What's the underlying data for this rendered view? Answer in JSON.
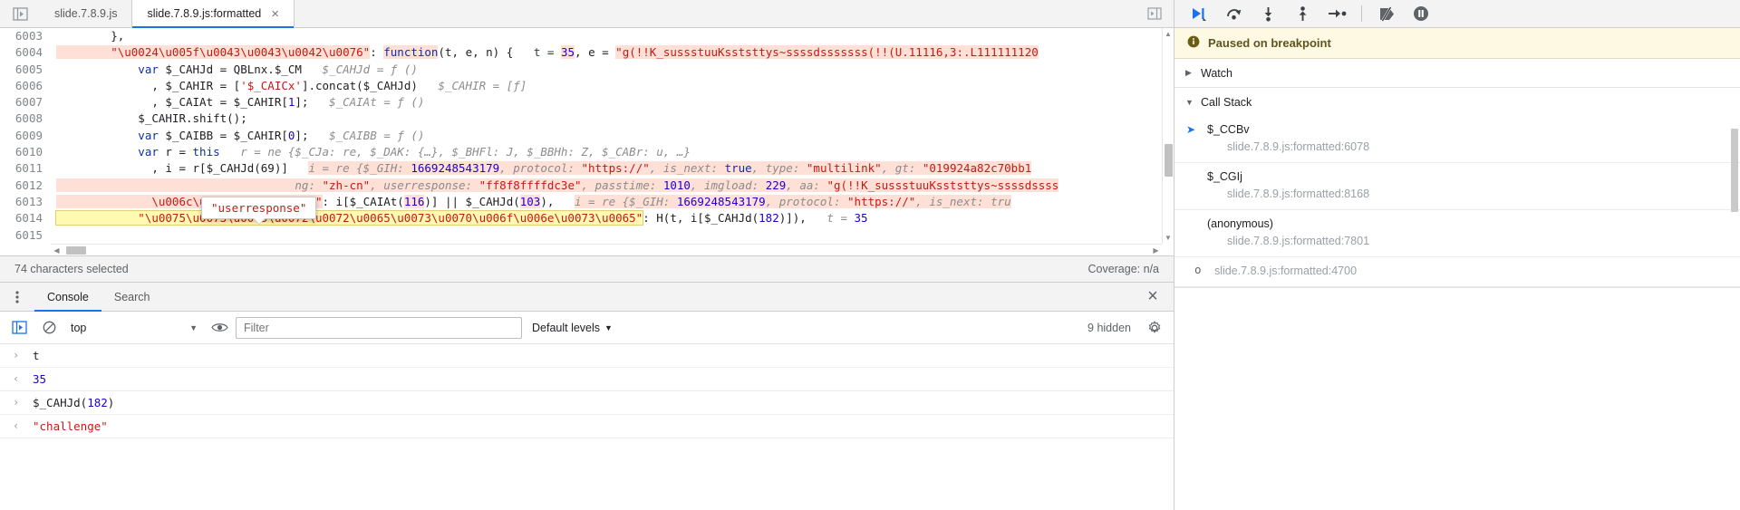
{
  "sources": {
    "tabs": [
      {
        "label": "slide.7.8.9.js",
        "active": false,
        "closable": false
      },
      {
        "label": "slide.7.8.9.js:formatted",
        "active": true,
        "closable": true,
        "close_glyph": "×"
      }
    ],
    "nav_icon": "show-navigator-icon",
    "right_icon": "show-debugger-icon",
    "code_lines": [
      {
        "no": "6003",
        "segments": [
          {
            "t": "        },",
            "cls": "pln"
          }
        ]
      },
      {
        "no": "6004",
        "segments": [
          {
            "t": "        \"\\u0024\\u005f\\u0043\\u0043\\u0042\\u0076\"",
            "cls": "str"
          },
          {
            "t": ": ",
            "cls": "pln"
          },
          {
            "t": "function",
            "cls": "k"
          },
          {
            "t": "(t, e, n) {",
            "cls": "pln"
          },
          {
            "t": "   t = ",
            "cls": "hintpad"
          },
          {
            "t": "35",
            "cls": "num"
          },
          {
            "t": ", e = ",
            "cls": "pln"
          },
          {
            "t": "\"g(!!K_sussstuuKsststtys~ssssdsssssss(!!(U.11116,3:.L111111120",
            "cls": "str"
          }
        ]
      },
      {
        "no": "6005",
        "segments": [
          {
            "t": "            var",
            "cls": "k"
          },
          {
            "t": " $_CAHJd = QBLnx.$_CM   ",
            "cls": "pln"
          },
          {
            "t": "$_CAHJd = ƒ ()",
            "cls": "hint"
          }
        ]
      },
      {
        "no": "6006",
        "segments": [
          {
            "t": "              , $_CAHIR = [",
            "cls": "pln"
          },
          {
            "t": "'$_CAICx'",
            "cls": "str"
          },
          {
            "t": "].concat($_CAHJd)   ",
            "cls": "pln"
          },
          {
            "t": "$_CAHIR = [ƒ]",
            "cls": "hint"
          }
        ]
      },
      {
        "no": "6007",
        "segments": [
          {
            "t": "              , $_CAIAt = $_CAHIR[",
            "cls": "pln"
          },
          {
            "t": "1",
            "cls": "num"
          },
          {
            "t": "];   ",
            "cls": "pln"
          },
          {
            "t": "$_CAIAt = ƒ ()",
            "cls": "hint"
          }
        ]
      },
      {
        "no": "6008",
        "segments": [
          {
            "t": "            $_CAHIR.shift();",
            "cls": "pln"
          }
        ]
      },
      {
        "no": "6009",
        "segments": [
          {
            "t": "            var",
            "cls": "k"
          },
          {
            "t": " $_CAIBB = $_CAHIR[",
            "cls": "pln"
          },
          {
            "t": "0",
            "cls": "num"
          },
          {
            "t": "];   ",
            "cls": "pln"
          },
          {
            "t": "$_CAIBB = ƒ ()",
            "cls": "hint"
          }
        ]
      },
      {
        "no": "6010",
        "segments": [
          {
            "t": "            var",
            "cls": "k"
          },
          {
            "t": " r = ",
            "cls": "pln"
          },
          {
            "t": "this",
            "cls": "k"
          },
          {
            "t": "   r = ne {$_CJa: re, $_DAK: {…}, $_BHFl: J, $_BBHh: Z, $_CABr: u, …}",
            "cls": "hint"
          }
        ]
      },
      {
        "no": "6011",
        "segments": [
          {
            "t": "              , i = r[$_CAHJd(69)]   ",
            "cls": "pln"
          },
          {
            "t": "i = re {$_GIH: ",
            "cls": "hint"
          },
          {
            "t": "1669248543179",
            "cls": "num"
          },
          {
            "t": ", protocol: ",
            "cls": "hint"
          },
          {
            "t": "\"https://\"",
            "cls": "str"
          },
          {
            "t": ", is_next: ",
            "cls": "hint"
          },
          {
            "t": "true",
            "cls": "k"
          },
          {
            "t": ", type: ",
            "cls": "hint"
          },
          {
            "t": "\"multilink\"",
            "cls": "str"
          },
          {
            "t": ", gt: ",
            "cls": "hint"
          },
          {
            "t": "\"019924a82c70bb1",
            "cls": "str"
          }
        ]
      },
      {
        "no": "6012",
        "segments": [
          {
            "t": "                                   ng: ",
            "cls": "hint"
          },
          {
            "t": "\"zh-cn\"",
            "cls": "str"
          },
          {
            "t": ", userresponse: ",
            "cls": "hint"
          },
          {
            "t": "\"ff8f8ffffdc3e\"",
            "cls": "str"
          },
          {
            "t": ", passtime: ",
            "cls": "hint"
          },
          {
            "t": "1010",
            "cls": "num"
          },
          {
            "t": ", imgload: ",
            "cls": "hint"
          },
          {
            "t": "229",
            "cls": "num"
          },
          {
            "t": ", aa: ",
            "cls": "hint"
          },
          {
            "t": "\"g(!!K_sussstuuKsststtys~ssssdssss",
            "cls": "str"
          }
        ]
      },
      {
        "no": "6013",
        "segments": [
          {
            "t": "              \\u006c\\u0061\\u006e\\u0067\"",
            "cls": "str"
          },
          {
            "t": ": i[$_CAIAt(",
            "cls": "pln"
          },
          {
            "t": "116",
            "cls": "num"
          },
          {
            "t": ")] || $_CAHJd(",
            "cls": "pln"
          },
          {
            "t": "103",
            "cls": "num"
          },
          {
            "t": "),   ",
            "cls": "pln"
          },
          {
            "t": "i = re {$_GIH: ",
            "cls": "hint"
          },
          {
            "t": "1669248543179",
            "cls": "num"
          },
          {
            "t": ", protocol: ",
            "cls": "hint"
          },
          {
            "t": "\"https://\"",
            "cls": "str"
          },
          {
            "t": ", is_next: tru",
            "cls": "hint"
          }
        ]
      },
      {
        "no": "6014",
        "segments": [
          {
            "t": "            \"\\u0075\\u0073\\u0065\\u0072\\u0072\\u0065\\u0073\\u0070\\u006f\\u006e\\u0073\\u0065\"",
            "cls": "str sel"
          },
          {
            "t": ": H(t, i[$_CAHJd(",
            "cls": "pln"
          },
          {
            "t": "182",
            "cls": "num"
          },
          {
            "t": ")]),   ",
            "cls": "pln"
          },
          {
            "t": "t = ",
            "cls": "hint"
          },
          {
            "t": "35",
            "cls": "num"
          }
        ]
      },
      {
        "no": "6015",
        "segments": [
          {
            "t": "",
            "cls": "pln"
          }
        ]
      }
    ],
    "tooltip_text": "\"userresponse\"",
    "status": {
      "selection": "74 characters selected",
      "coverage": "Coverage: n/a"
    }
  },
  "drawer": {
    "menu_icon": "more-options-icon",
    "tabs": [
      {
        "label": "Console",
        "active": true
      },
      {
        "label": "Search",
        "active": false
      }
    ],
    "close_glyph": "×",
    "toolbar": {
      "sidebar_icon": "console-sidebar-icon",
      "clear_icon": "clear-console-icon",
      "context": "top",
      "context_caret": "▼",
      "eye_icon": "live-expression-icon",
      "filter_placeholder": "Filter",
      "filter_value": "",
      "levels_label": "Default levels",
      "levels_caret": "▼",
      "hidden_label": "9 hidden",
      "settings_icon": "gear-icon"
    },
    "messages": [
      {
        "kind": "input",
        "glyph": "›",
        "parts": [
          {
            "t": "t",
            "cls": "pln"
          }
        ]
      },
      {
        "kind": "result",
        "glyph": "‹",
        "parts": [
          {
            "t": "35",
            "cls": "num"
          }
        ]
      },
      {
        "kind": "input",
        "glyph": "›",
        "parts": [
          {
            "t": "$_CAHJd(",
            "cls": "pln"
          },
          {
            "t": "182",
            "cls": "num"
          },
          {
            "t": ")",
            "cls": "pln"
          }
        ]
      },
      {
        "kind": "result",
        "glyph": "‹",
        "parts": [
          {
            "t": "\"challenge\"",
            "cls": "str"
          }
        ]
      }
    ]
  },
  "debugger": {
    "toolbar": [
      {
        "name": "resume-button",
        "icon": "resume-script-execution-icon"
      },
      {
        "name": "step-over-button",
        "icon": "step-over-next-function-call-icon"
      },
      {
        "name": "step-into-button",
        "icon": "step-into-next-function-call-icon"
      },
      {
        "name": "step-out-button",
        "icon": "step-out-of-current-function-icon"
      },
      {
        "name": "step-button",
        "icon": "step-icon"
      },
      {
        "name": "deactivate-breakpoints-button",
        "icon": "deactivate-breakpoints-icon"
      },
      {
        "name": "pause-on-exceptions-button",
        "icon": "pause-on-exceptions-icon"
      }
    ],
    "paused_banner": {
      "icon": "info-icon",
      "text": "Paused on breakpoint"
    },
    "watch": {
      "label": "Watch",
      "caret": "▶",
      "expanded": false
    },
    "call_stack": {
      "label": "Call Stack",
      "caret": "▼",
      "expanded": true,
      "frames": [
        {
          "name": "$_CCBv",
          "location": "slide.7.8.9.js:formatted:6078",
          "selected": true,
          "async_badge": ""
        },
        {
          "name": "$_CGIj",
          "location": "slide.7.8.9.js:formatted:8168",
          "selected": false,
          "async_badge": ""
        },
        {
          "name": "(anonymous)",
          "location": "slide.7.8.9.js:formatted:7801",
          "selected": false,
          "async_badge": ""
        },
        {
          "name": "",
          "location": "slide.7.8.9.js:formatted:4700",
          "selected": false,
          "async_badge": "o"
        }
      ]
    }
  },
  "colors": {
    "accent": "#1a73e8",
    "string": "#c41a16",
    "number": "#1c00cf",
    "keyword": "#0b2cb7",
    "paused_bg": "#fdf9e2",
    "selection_bg": "#fff9b1",
    "highlight_bg": "#ffe0d6"
  }
}
